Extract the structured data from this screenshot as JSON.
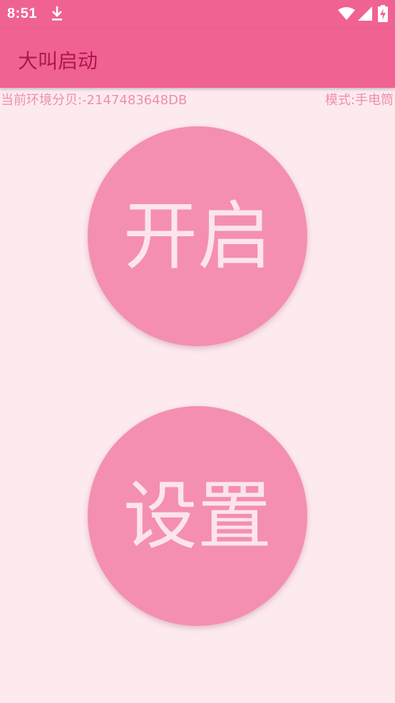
{
  "status_bar": {
    "time": "8:51",
    "icons": [
      "download-icon",
      "wifi-icon",
      "signal-icon",
      "battery-charging-icon"
    ],
    "icon_color": "#FFFFFF"
  },
  "app_bar": {
    "title": "大叫启动",
    "background_color": "#F06292",
    "title_color": "#B0164F"
  },
  "info": {
    "db_label": "当前环境分贝:-2147483648DB",
    "mode_label": "模式:手电筒",
    "text_color": "#EE8EB0"
  },
  "buttons": {
    "start_label": "开启",
    "settings_label": "设置",
    "background_color": "#F48FB1",
    "text_color": "#FCE4EC"
  },
  "page_background": "#FDEAEE"
}
